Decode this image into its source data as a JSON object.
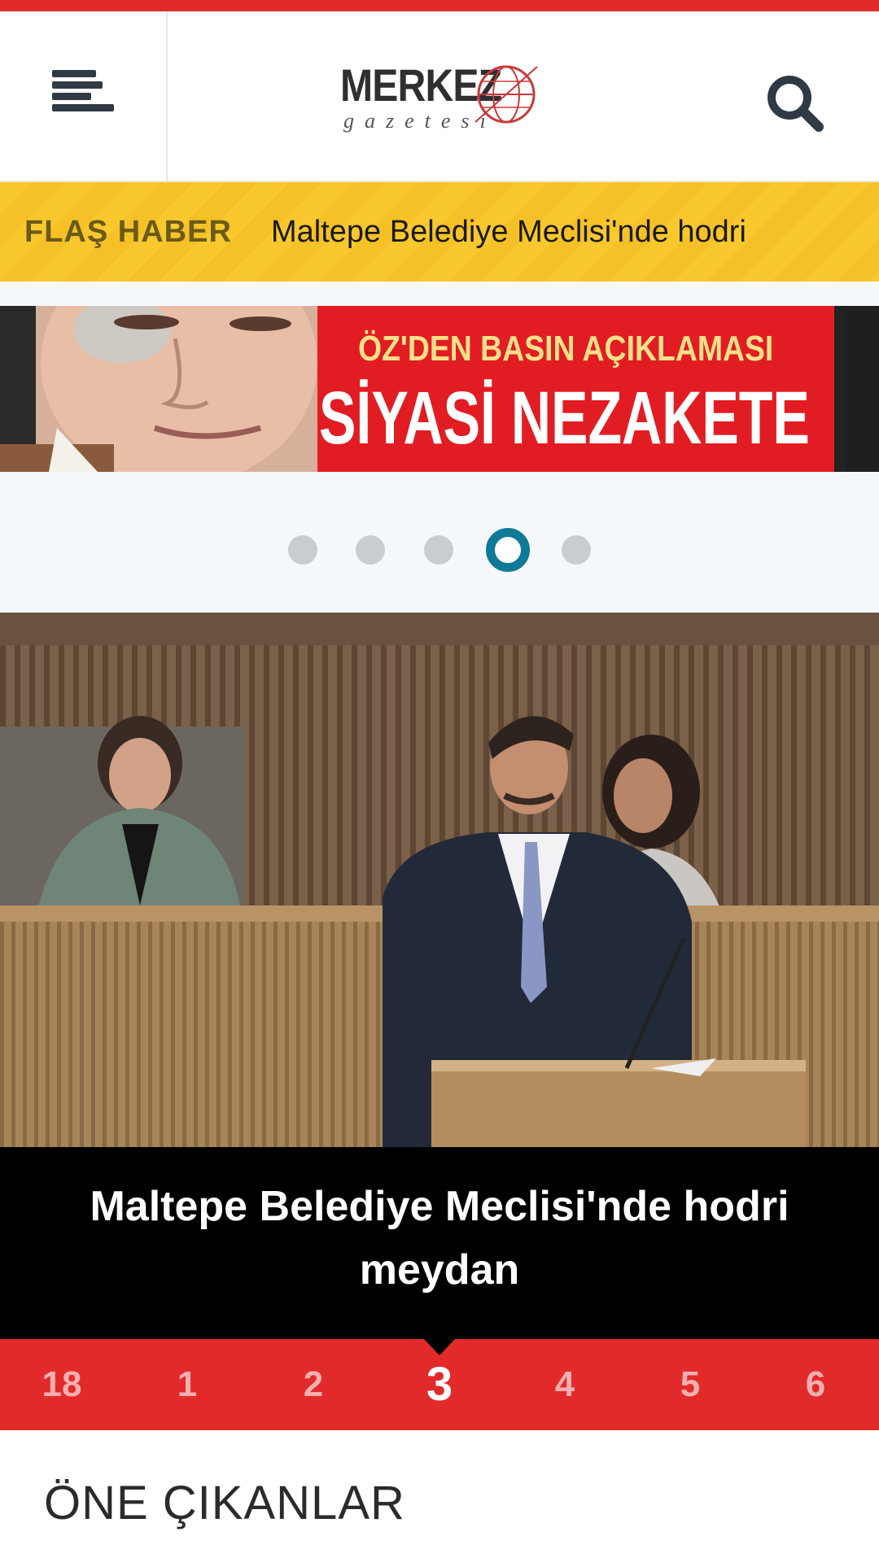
{
  "header": {
    "logo_word": "MERKEZ",
    "logo_sub": "gazetesi"
  },
  "flash": {
    "label": "FLAŞ HABER",
    "text": "Maltepe Belediye Meclisi'nde hodri"
  },
  "banner": {
    "line1": "ÖZ'DEN BASIN AÇIKLAMASI",
    "line2": "SİYASİ NEZAKETE"
  },
  "slider": {
    "dot_count": 5,
    "active_dot": 4
  },
  "hero": {
    "title": "Maltepe Belediye Meclisi'nde hodri meydan"
  },
  "pager": {
    "pages": [
      "18",
      "1",
      "2",
      "3",
      "4",
      "5",
      "6"
    ],
    "active": "3"
  },
  "section": {
    "title": "ÖNE ÇIKANLAR"
  },
  "colors": {
    "accent_red": "#e32a2a",
    "flash_yellow": "#f9c82c",
    "active_dot": "#0e7a97"
  },
  "icons": {
    "menu": "hamburger-menu-icon",
    "search": "search-icon"
  }
}
